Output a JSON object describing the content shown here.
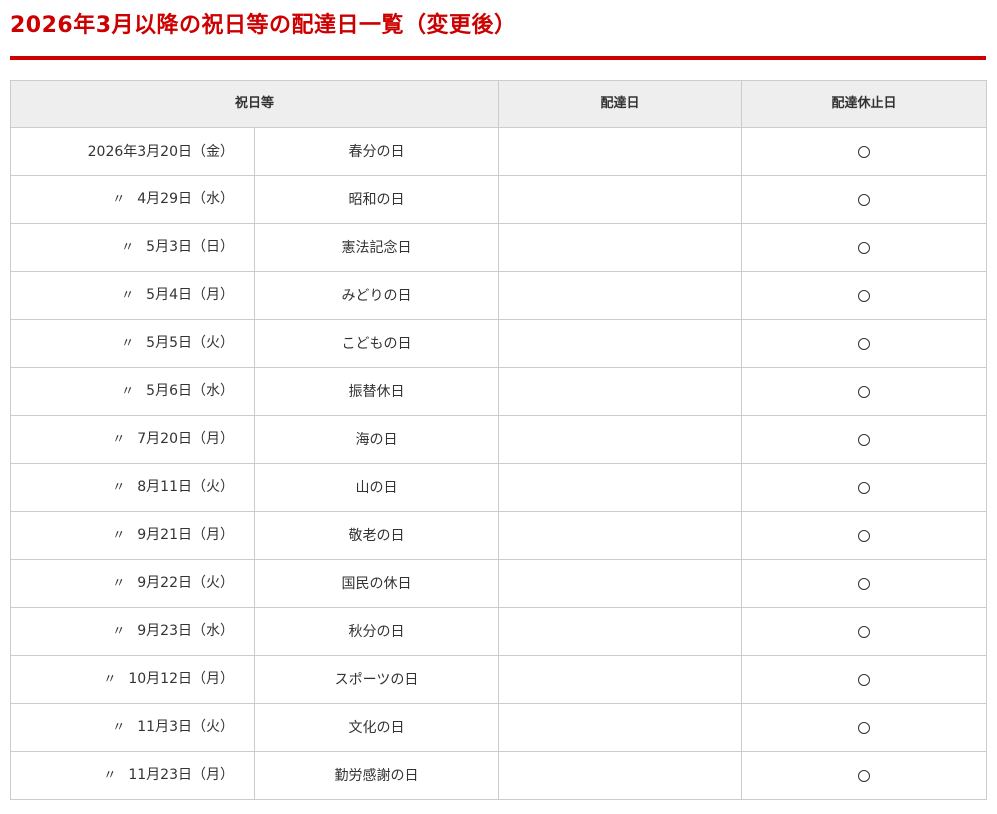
{
  "page": {
    "title": "2026年3月以降の祝日等の配達日一覧（変更後）"
  },
  "table": {
    "headers": {
      "holiday": "祝日等",
      "delivery_day": "配達日",
      "suspension_day": "配達休止日"
    },
    "rows": [
      {
        "ditto": "",
        "date": "2026年3月20日（金）",
        "name": "春分の日",
        "delivery": "",
        "suspended": true
      },
      {
        "ditto": "〃",
        "date": "4月29日（水）",
        "name": "昭和の日",
        "delivery": "",
        "suspended": true
      },
      {
        "ditto": "〃",
        "date": "5月3日（日）",
        "name": "憲法記念日",
        "delivery": "",
        "suspended": true
      },
      {
        "ditto": "〃",
        "date": "5月4日（月）",
        "name": "みどりの日",
        "delivery": "",
        "suspended": true
      },
      {
        "ditto": "〃",
        "date": "5月5日（火）",
        "name": "こどもの日",
        "delivery": "",
        "suspended": true
      },
      {
        "ditto": "〃",
        "date": "5月6日（水）",
        "name": "振替休日",
        "delivery": "",
        "suspended": true
      },
      {
        "ditto": "〃",
        "date": "7月20日（月）",
        "name": "海の日",
        "delivery": "",
        "suspended": true
      },
      {
        "ditto": "〃",
        "date": "8月11日（火）",
        "name": "山の日",
        "delivery": "",
        "suspended": true
      },
      {
        "ditto": "〃",
        "date": "9月21日（月）",
        "name": "敬老の日",
        "delivery": "",
        "suspended": true
      },
      {
        "ditto": "〃",
        "date": "9月22日（火）",
        "name": "国民の休日",
        "delivery": "",
        "suspended": true
      },
      {
        "ditto": "〃",
        "date": "9月23日（水）",
        "name": "秋分の日",
        "delivery": "",
        "suspended": true
      },
      {
        "ditto": "〃",
        "date": "10月12日（月）",
        "name": "スポーツの日",
        "delivery": "",
        "suspended": true
      },
      {
        "ditto": "〃",
        "date": "11月3日（火）",
        "name": "文化の日",
        "delivery": "",
        "suspended": true
      },
      {
        "ditto": "〃",
        "date": "11月23日（月）",
        "name": "勤労感謝の日",
        "delivery": "",
        "suspended": true
      }
    ]
  },
  "colors": {
    "accent": "#cc0000",
    "header_bg": "#eeeeee",
    "border": "#cccccc",
    "text": "#333333"
  },
  "icons": {
    "suspension_mark": "circle-mark-icon"
  }
}
